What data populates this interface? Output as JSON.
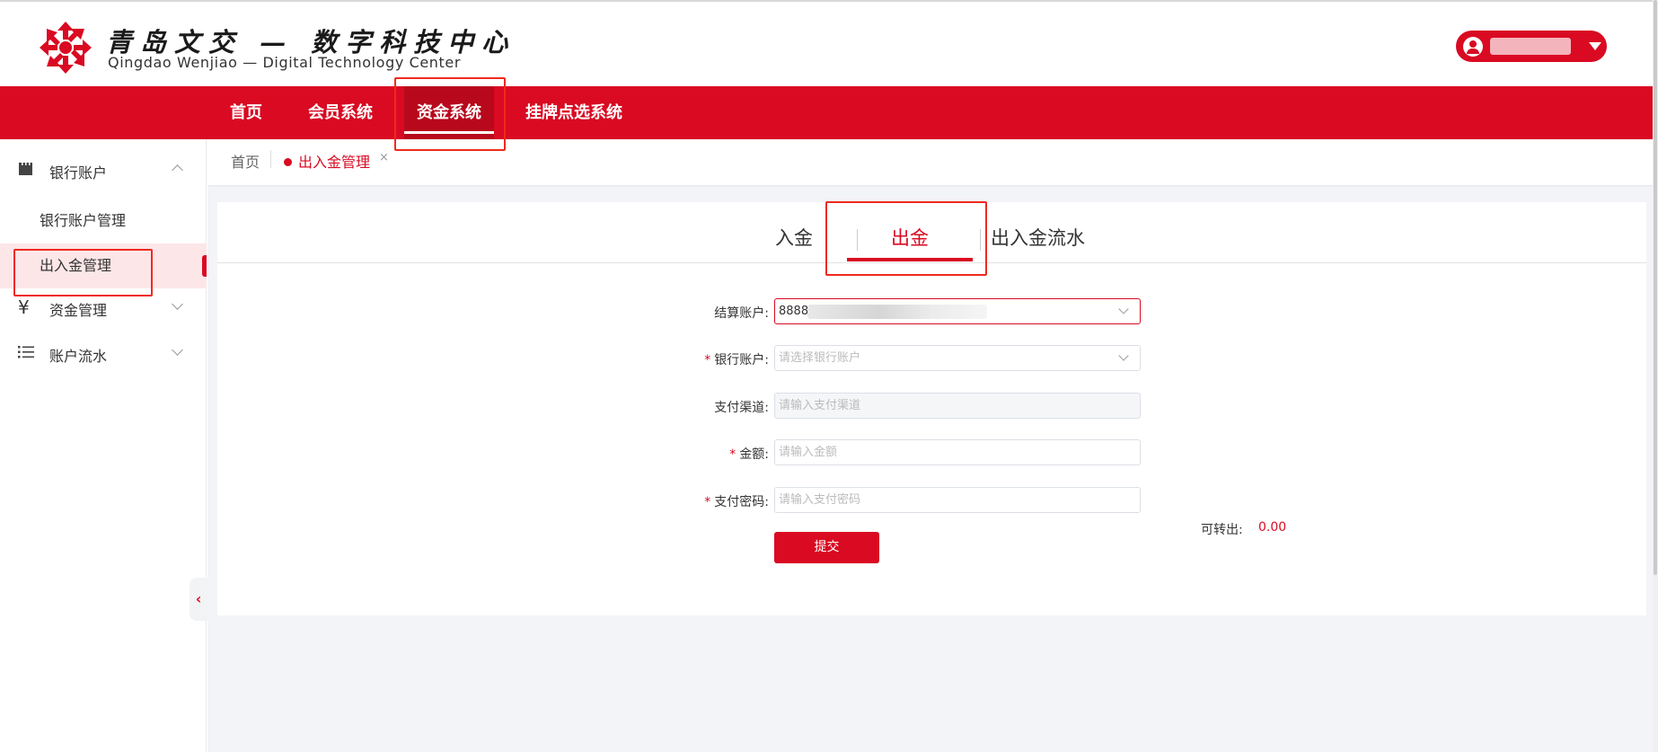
{
  "header": {
    "logo_cn": "青岛文交 — 数字科技中心",
    "logo_en": "Qingdao Wenjiao — Digital Technology Center",
    "brand_color": "#d90a22"
  },
  "nav": {
    "items": [
      {
        "label": "首页"
      },
      {
        "label": "会员系统"
      },
      {
        "label": "资金系统"
      },
      {
        "label": "挂牌点选系统"
      }
    ]
  },
  "sidebar": {
    "groups": [
      {
        "label": "银行账户",
        "icon": "bank-icon",
        "children": [
          "银行账户管理",
          "出入金管理"
        ]
      },
      {
        "label": "资金管理",
        "icon": "yen-icon"
      },
      {
        "label": "账户流水",
        "icon": "list-icon"
      }
    ]
  },
  "tags": {
    "home": "首页",
    "active": "出入金管理",
    "close": "×"
  },
  "tabs": [
    "入金",
    "出金",
    "出入金流水"
  ],
  "form": {
    "settlement_label": "结算账户:",
    "settlement_value": "8888",
    "bank_label": "银行账户:",
    "bank_placeholder": "请选择银行账户",
    "channel_label": "支付渠道:",
    "channel_placeholder": "请输入支付渠道",
    "amount_label": "金额:",
    "amount_placeholder": "请输入金额",
    "password_label": "支付密码:",
    "password_placeholder": "请输入支付密码",
    "available_label": "可转出:",
    "available_value": "0.00",
    "submit": "提交",
    "required_mark": "*"
  }
}
